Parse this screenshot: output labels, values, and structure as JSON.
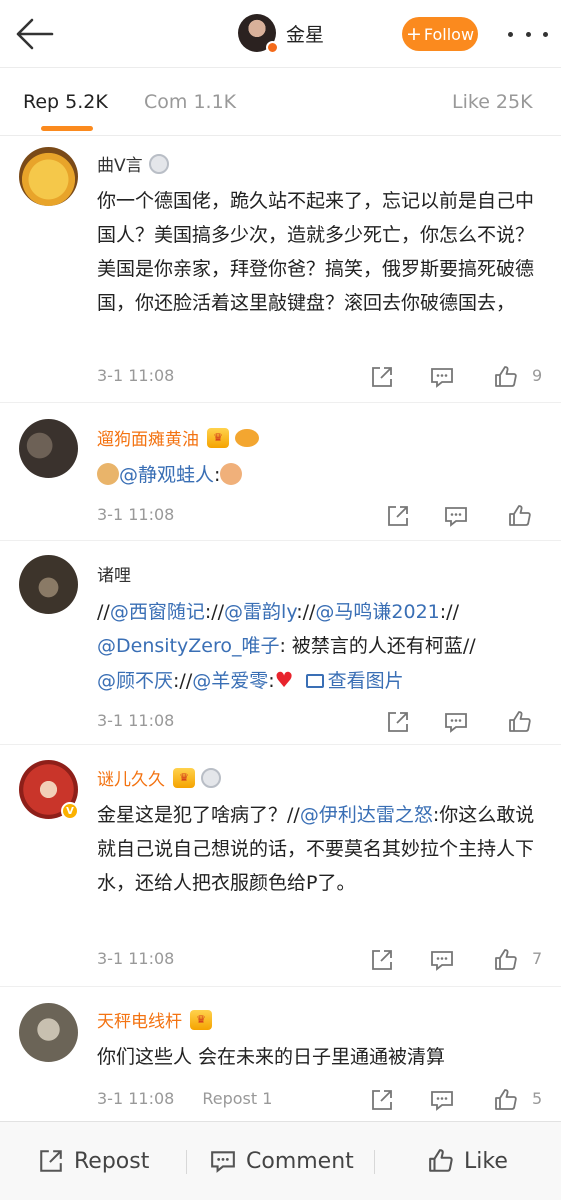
{
  "header": {
    "user_name": "金星",
    "follow_label": "Follow"
  },
  "tabs": [
    {
      "label": "Rep 5.2K"
    },
    {
      "label": "Com 1.1K"
    },
    {
      "label": "Like 25K"
    }
  ],
  "comments": [
    {
      "user": "曲V言",
      "text": "你一个德国佬，跪久站不起来了，忘记以前是自己中国人？美国搞多少次，造就多少死亡，你怎么不说？美国是你亲家，拜登你爸？搞笑，俄罗斯要搞死破德国，你还脸活着这里敲键盘？滚回去你破德国去，",
      "time": "3-1 11:08",
      "likes": "9"
    },
    {
      "user": "遛狗面瘫黄油",
      "mention": "@静观蛙人",
      "after_mention": ":",
      "time": "3-1 11:08",
      "likes": ""
    },
    {
      "user": "诸哩",
      "parts": [
        "//",
        "@西窗随记",
        "://",
        "@雷韵ly",
        "://",
        "@马鸣谦2021",
        "://",
        "@DensityZero_唯子",
        ": 被禁言的人还有柯蓝//",
        "@顾不厌",
        "://",
        "@羊爱零",
        ":",
        "查看图片"
      ],
      "time": "3-1 11:08",
      "likes": ""
    },
    {
      "user": "谜儿久久",
      "text_before": "金星这是犯了啥病了？//",
      "mention": "@伊利达雷之怒",
      "text_after": ":你这么敢说就自己说自己想说的话，不要莫名其妙拉个主持人下水，还给人把衣服颜色给P了。",
      "time": "3-1 11:08",
      "likes": "7"
    },
    {
      "user": "天秤电线杆",
      "text": "你们这些人 会在未来的日子里通通被清算",
      "time": "3-1 11:08",
      "repost": "Repost 1",
      "likes": "5"
    }
  ],
  "bottom_bar": {
    "repost_label": "Repost",
    "comment_label": "Comment",
    "like_label": "Like"
  },
  "colors": {
    "accent": "#fb8a1e",
    "username_orange": "#f37312",
    "link": "#3a6fb5",
    "muted": "#999999"
  }
}
